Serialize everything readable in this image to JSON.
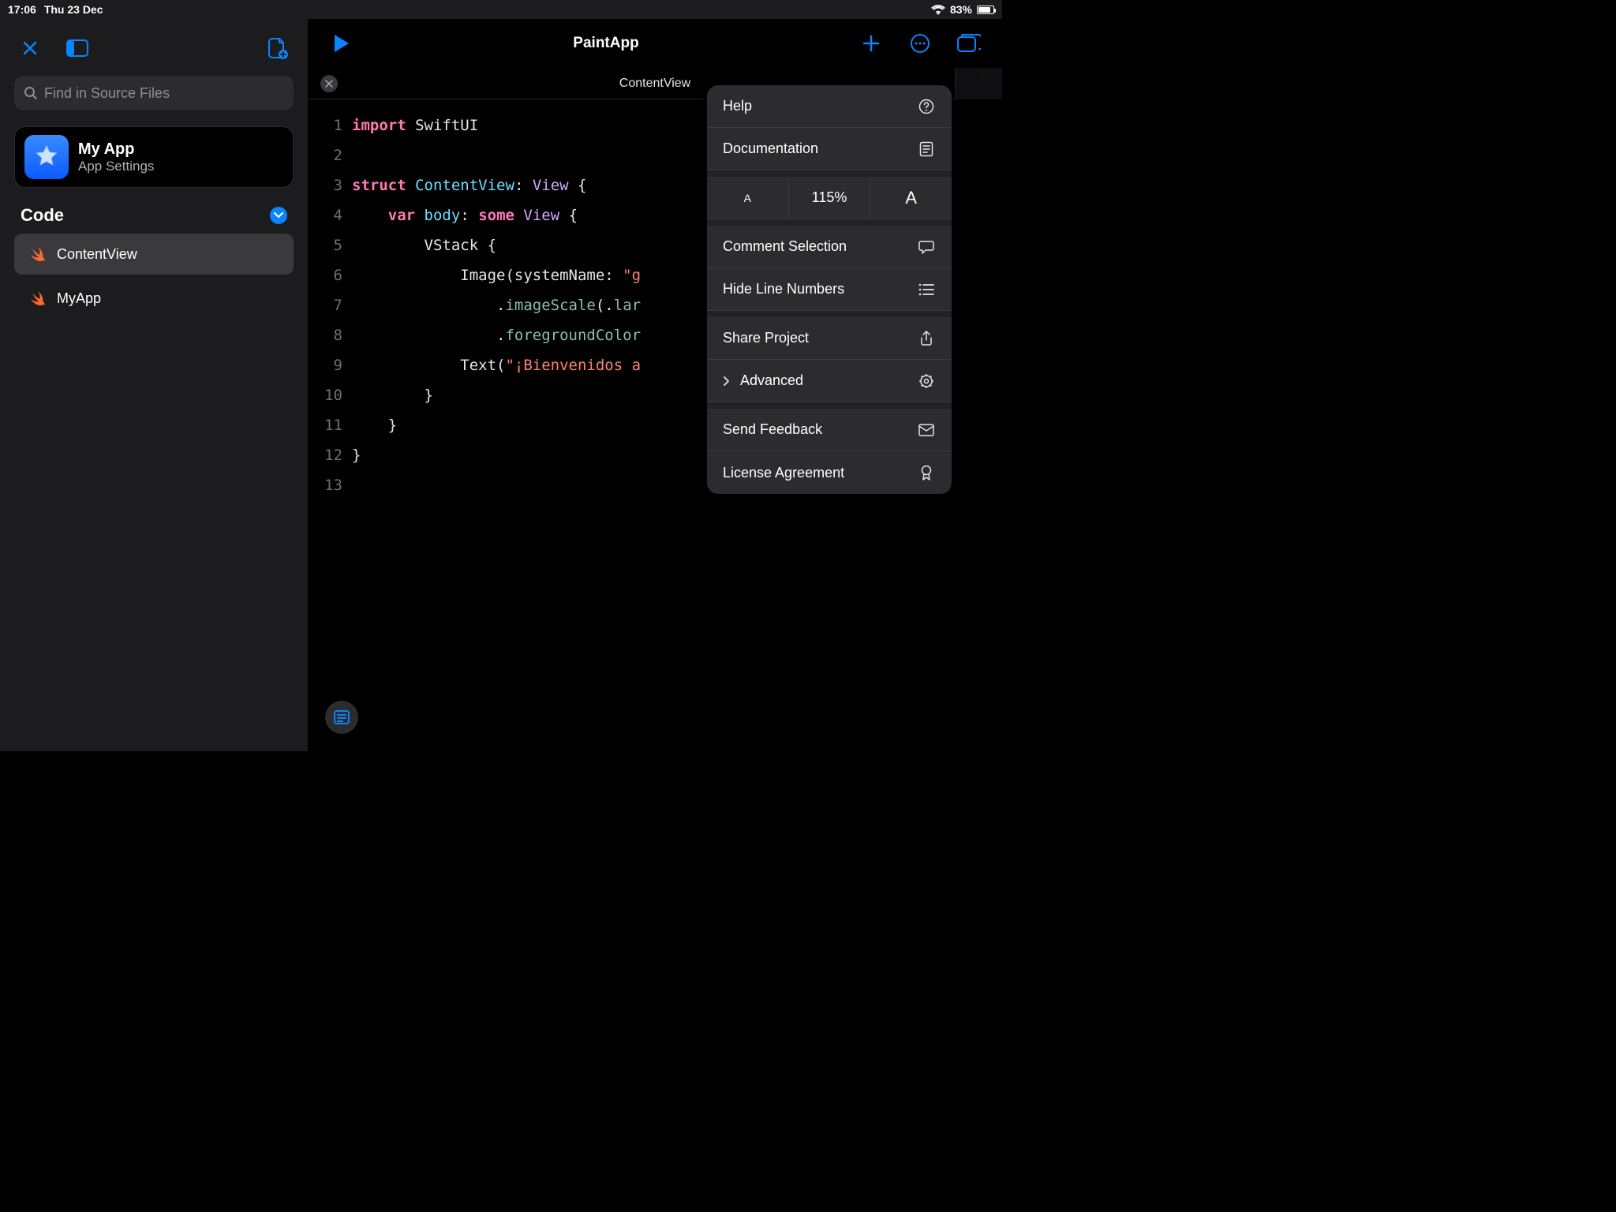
{
  "status": {
    "time": "17:06",
    "date": "Thu 23 Dec",
    "battery_pct": "83%",
    "battery_fill_pct": 83
  },
  "sidebar": {
    "search_placeholder": "Find in Source Files",
    "project": {
      "title": "My App",
      "subtitle": "App Settings"
    },
    "section_label": "Code",
    "files": [
      {
        "name": "ContentView"
      },
      {
        "name": "MyApp"
      }
    ]
  },
  "editor": {
    "title": "PaintApp",
    "tab_title": "ContentView",
    "line_count": 13,
    "code_lines": [
      {
        "tokens": [
          {
            "t": "import",
            "c": "kw-pink"
          },
          {
            "t": " SwiftUI",
            "c": ""
          }
        ]
      },
      {
        "tokens": []
      },
      {
        "tokens": [
          {
            "t": "struct",
            "c": "kw-pink"
          },
          {
            "t": " ",
            "c": ""
          },
          {
            "t": "ContentView",
            "c": "kw-teal"
          },
          {
            "t": ": ",
            "c": ""
          },
          {
            "t": "View",
            "c": "kw-purple"
          },
          {
            "t": " {",
            "c": ""
          }
        ]
      },
      {
        "tokens": [
          {
            "t": "    ",
            "c": ""
          },
          {
            "t": "var",
            "c": "kw-pink"
          },
          {
            "t": " ",
            "c": ""
          },
          {
            "t": "body",
            "c": "kw-teal"
          },
          {
            "t": ": ",
            "c": ""
          },
          {
            "t": "some",
            "c": "kw-pink"
          },
          {
            "t": " ",
            "c": ""
          },
          {
            "t": "View",
            "c": "kw-purple"
          },
          {
            "t": " {",
            "c": ""
          }
        ]
      },
      {
        "tokens": [
          {
            "t": "        VStack {",
            "c": ""
          }
        ]
      },
      {
        "tokens": [
          {
            "t": "            Image(systemName: ",
            "c": ""
          },
          {
            "t": "\"g",
            "c": "kw-red"
          }
        ]
      },
      {
        "tokens": [
          {
            "t": "                .",
            "c": ""
          },
          {
            "t": "imageScale",
            "c": "kw-green"
          },
          {
            "t": "(.",
            "c": ""
          },
          {
            "t": "lar",
            "c": "kw-green"
          }
        ]
      },
      {
        "tokens": [
          {
            "t": "                .",
            "c": ""
          },
          {
            "t": "foregroundColor",
            "c": "kw-green"
          }
        ]
      },
      {
        "tokens": [
          {
            "t": "            Text(",
            "c": ""
          },
          {
            "t": "\"¡Bienvenidos a",
            "c": "kw-red"
          }
        ]
      },
      {
        "tokens": [
          {
            "t": "        }",
            "c": ""
          }
        ]
      },
      {
        "tokens": [
          {
            "t": "    }",
            "c": ""
          }
        ]
      },
      {
        "tokens": [
          {
            "t": "}",
            "c": ""
          }
        ]
      },
      {
        "tokens": []
      }
    ]
  },
  "popover": {
    "help": "Help",
    "documentation": "Documentation",
    "zoom_dec": "A",
    "zoom_level": "115%",
    "zoom_inc": "A",
    "comment_selection": "Comment Selection",
    "hide_line_numbers": "Hide Line Numbers",
    "share_project": "Share Project",
    "advanced": "Advanced",
    "send_feedback": "Send Feedback",
    "license_agreement": "License Agreement"
  }
}
